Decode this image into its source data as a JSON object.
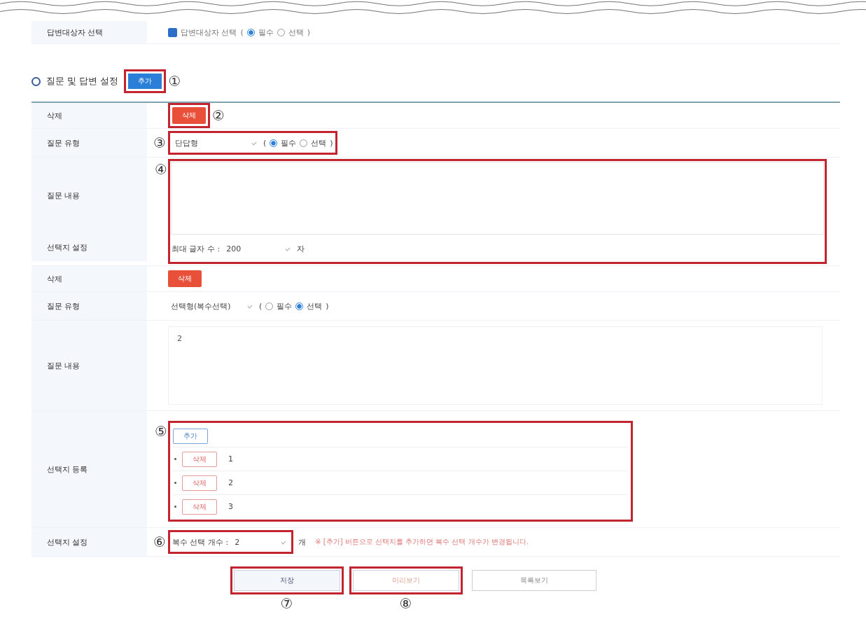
{
  "top_row": {
    "label": "답변대상자 선택",
    "checkbox": {
      "label": "답변대상자 선택",
      "checked": true
    },
    "paren_open": "(",
    "radios": [
      {
        "label": "필수",
        "selected": true
      },
      {
        "label": "선택",
        "selected": false
      }
    ],
    "paren_close": ")"
  },
  "section": {
    "title": "질문 및 답변 설정",
    "add_button": "추가",
    "annotation": "①"
  },
  "questions": [
    {
      "delete_row": {
        "label": "삭제",
        "button": "삭제",
        "annotation": "②"
      },
      "type_row": {
        "label": "질문 유형",
        "select": "단답형",
        "paren_open": "(",
        "radios": [
          {
            "label": "필수",
            "selected": true
          },
          {
            "label": "선택",
            "selected": false
          }
        ],
        "paren_close": ")",
        "annotation": "③"
      },
      "content_row": {
        "label": "질문 내용",
        "annotation": "④"
      },
      "setting_row": {
        "kind": "max_length",
        "label": "선택지 설정",
        "prefix": "최대 글자 수 :",
        "select": "200",
        "unit": "자"
      }
    },
    {
      "delete_row": {
        "label": "삭제",
        "button": "삭제"
      },
      "type_row": {
        "label": "질문 유형",
        "select": "선택형(복수선택)",
        "paren_open": "(",
        "radios": [
          {
            "label": "필수",
            "selected": false
          },
          {
            "label": "선택",
            "selected": true
          }
        ],
        "paren_close": ")"
      },
      "content_row": {
        "label": "질문 내용",
        "value": "2"
      },
      "choices_row": {
        "label": "선택지 등록",
        "add_button": "추가",
        "annotation": "⑤",
        "items": [
          {
            "button": "삭제",
            "value": "1"
          },
          {
            "button": "삭제",
            "value": "2"
          },
          {
            "button": "삭제",
            "value": "3"
          }
        ]
      },
      "setting_row": {
        "kind": "multi_count",
        "label": "선택지 설정",
        "prefix": "복수 선택 개수 :",
        "select": "2",
        "unit": "개",
        "note": "※ [추가] 버튼으로 선택지를 추가하면 복수 선택 개수가 변경됩니다.",
        "annotation": "⑥"
      }
    }
  ],
  "footer_buttons": [
    {
      "label": "저장",
      "kind": "save",
      "annotation": "⑦"
    },
    {
      "label": "미리보기",
      "kind": "preview",
      "annotation": "⑧"
    },
    {
      "label": "목록보기",
      "kind": "list"
    }
  ]
}
